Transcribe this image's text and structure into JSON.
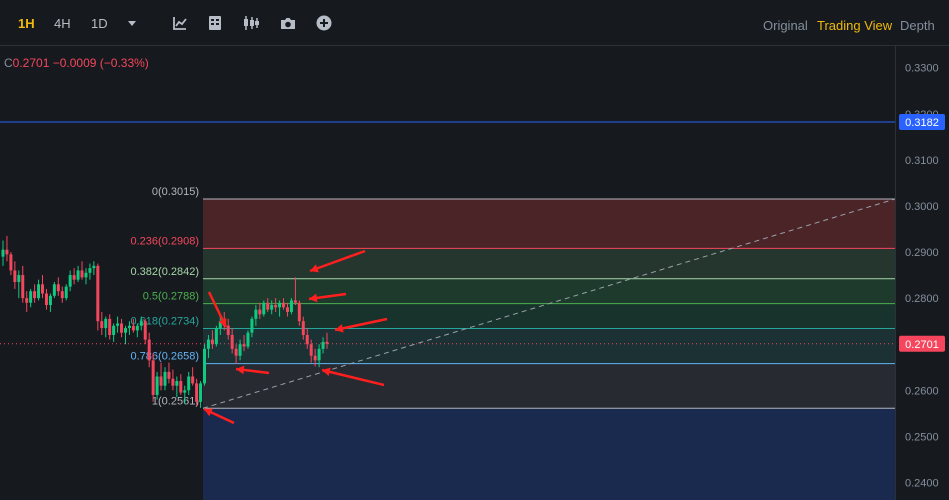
{
  "toolbar": {
    "timeframes": [
      {
        "label": "1H",
        "active": true
      },
      {
        "label": "4H",
        "active": false
      },
      {
        "label": "1D",
        "active": false
      }
    ],
    "icons": [
      "chevron-down-icon",
      "indicator-icon",
      "template-icon",
      "candle-type-icon",
      "camera-icon",
      "add-icon"
    ],
    "views": [
      {
        "label": "Original",
        "active": false
      },
      {
        "label": "Trading View",
        "active": true
      },
      {
        "label": "Depth",
        "active": false
      }
    ]
  },
  "legend": {
    "close_label": "C",
    "close": "0.2701",
    "change": "−0.0009",
    "change_pct": "(−0.33%)"
  },
  "colors": {
    "bg": "#161a1e",
    "up": "#0ecb81",
    "down": "#f6465d",
    "accent": "#f0b90b",
    "horizontal_line": "#2962ff",
    "arrow": "#ff1f1f"
  },
  "chart_data": {
    "type": "candlestick",
    "price_axis": {
      "ticks": [
        "0.3300",
        "0.3200",
        "0.3100",
        "0.3000",
        "0.2900",
        "0.2800",
        "0.2700",
        "0.2600",
        "0.2500",
        "0.2400"
      ],
      "tick_values": [
        0.33,
        0.32,
        0.31,
        0.3,
        0.29,
        0.28,
        0.27,
        0.26,
        0.25,
        0.24
      ],
      "range": [
        0.2362,
        0.3347
      ]
    },
    "horizontal_line": {
      "price": 0.3182,
      "label": "0.3182"
    },
    "current_price": {
      "price": 0.2701,
      "label": "0.2701"
    },
    "fib_levels": [
      {
        "ratio": "0",
        "price": 0.3015,
        "label": "0(0.3015)",
        "color": "#b2b5be",
        "fill": "#4a2427"
      },
      {
        "ratio": "0.236",
        "price": 0.2908,
        "label": "0.236(0.2908)",
        "color": "#f6465d",
        "fill": "#24362e"
      },
      {
        "ratio": "0.382",
        "price": 0.2842,
        "label": "0.382(0.2842)",
        "color": "#a5d6a7",
        "fill": "#1d3a2c"
      },
      {
        "ratio": "0.5",
        "price": 0.2788,
        "label": "0.5(0.2788)",
        "color": "#4caf50",
        "fill": "#18332b"
      },
      {
        "ratio": "0.618",
        "price": 0.2734,
        "label": "0.618(0.2734)",
        "color": "#26a69a",
        "fill": "#1b3134"
      },
      {
        "ratio": "0.786",
        "price": 0.2658,
        "label": "0.786(0.2658)",
        "color": "#64b5f6",
        "fill": "#272a31"
      },
      {
        "ratio": "1",
        "price": 0.2561,
        "label": "1(0.2561)",
        "color": "#b2b5be",
        "fill": "#1a2a4f"
      }
    ],
    "trend_line": {
      "from_price": 0.2561,
      "to_price": 0.3015
    },
    "arrows": [
      {
        "target_price": 0.2842,
        "direction": "left"
      },
      {
        "target_price": 0.28,
        "direction": "left"
      },
      {
        "target_price": 0.2785,
        "direction": "down-right"
      },
      {
        "target_price": 0.274,
        "direction": "left"
      },
      {
        "target_price": 0.2657,
        "direction": "left"
      },
      {
        "target_price": 0.2652,
        "direction": "left"
      },
      {
        "target_price": 0.2562,
        "direction": "left"
      }
    ],
    "candles": [
      [
        0.289,
        0.2925,
        0.287,
        0.2905
      ],
      [
        0.2905,
        0.2935,
        0.288,
        0.2895
      ],
      [
        0.2895,
        0.29,
        0.285,
        0.286
      ],
      [
        0.286,
        0.288,
        0.282,
        0.2835
      ],
      [
        0.2835,
        0.286,
        0.28,
        0.285
      ],
      [
        0.285,
        0.287,
        0.279,
        0.28
      ],
      [
        0.28,
        0.2815,
        0.277,
        0.279
      ],
      [
        0.279,
        0.282,
        0.278,
        0.2815
      ],
      [
        0.2815,
        0.283,
        0.279,
        0.28
      ],
      [
        0.28,
        0.284,
        0.2795,
        0.283
      ],
      [
        0.283,
        0.285,
        0.28,
        0.281
      ],
      [
        0.281,
        0.282,
        0.2775,
        0.2785
      ],
      [
        0.2785,
        0.281,
        0.277,
        0.2805
      ],
      [
        0.2805,
        0.2835,
        0.28,
        0.283
      ],
      [
        0.283,
        0.2845,
        0.2805,
        0.2815
      ],
      [
        0.2815,
        0.2825,
        0.279,
        0.28
      ],
      [
        0.28,
        0.283,
        0.2795,
        0.2825
      ],
      [
        0.2825,
        0.286,
        0.2815,
        0.285
      ],
      [
        0.285,
        0.2865,
        0.283,
        0.284
      ],
      [
        0.284,
        0.287,
        0.2835,
        0.286
      ],
      [
        0.286,
        0.288,
        0.284,
        0.2845
      ],
      [
        0.2845,
        0.2865,
        0.283,
        0.2855
      ],
      [
        0.2855,
        0.2875,
        0.284,
        0.2865
      ],
      [
        0.2865,
        0.288,
        0.285,
        0.287
      ],
      [
        0.287,
        0.2875,
        0.273,
        0.275
      ],
      [
        0.275,
        0.277,
        0.272,
        0.2735
      ],
      [
        0.2735,
        0.276,
        0.2715,
        0.2755
      ],
      [
        0.2755,
        0.2765,
        0.271,
        0.272
      ],
      [
        0.272,
        0.2745,
        0.2705,
        0.274
      ],
      [
        0.274,
        0.276,
        0.2725,
        0.2745
      ],
      [
        0.2745,
        0.2755,
        0.2715,
        0.2725
      ],
      [
        0.2725,
        0.274,
        0.27,
        0.2735
      ],
      [
        0.2735,
        0.275,
        0.272,
        0.274
      ],
      [
        0.274,
        0.2755,
        0.2725,
        0.273
      ],
      [
        0.273,
        0.2745,
        0.2715,
        0.274
      ],
      [
        0.274,
        0.276,
        0.273,
        0.275
      ],
      [
        0.275,
        0.2755,
        0.27,
        0.271
      ],
      [
        0.271,
        0.2725,
        0.265,
        0.2665
      ],
      [
        0.2665,
        0.268,
        0.2575,
        0.259
      ],
      [
        0.259,
        0.264,
        0.258,
        0.263
      ],
      [
        0.263,
        0.266,
        0.26,
        0.261
      ],
      [
        0.261,
        0.265,
        0.26,
        0.264
      ],
      [
        0.264,
        0.266,
        0.2615,
        0.2625
      ],
      [
        0.2625,
        0.2645,
        0.26,
        0.261
      ],
      [
        0.261,
        0.263,
        0.2585,
        0.262
      ],
      [
        0.262,
        0.2635,
        0.259,
        0.2595
      ],
      [
        0.2595,
        0.261,
        0.257,
        0.26
      ],
      [
        0.26,
        0.264,
        0.259,
        0.263
      ],
      [
        0.263,
        0.265,
        0.261,
        0.2615
      ],
      [
        0.2615,
        0.2625,
        0.2565,
        0.2575
      ],
      [
        0.2575,
        0.262,
        0.2562,
        0.2615
      ],
      [
        0.2615,
        0.27,
        0.261,
        0.269
      ],
      [
        0.269,
        0.272,
        0.267,
        0.271
      ],
      [
        0.271,
        0.273,
        0.269,
        0.27
      ],
      [
        0.27,
        0.274,
        0.2695,
        0.2735
      ],
      [
        0.2735,
        0.276,
        0.272,
        0.275
      ],
      [
        0.275,
        0.277,
        0.273,
        0.274
      ],
      [
        0.274,
        0.2755,
        0.271,
        0.272
      ],
      [
        0.272,
        0.2735,
        0.268,
        0.269
      ],
      [
        0.269,
        0.27,
        0.2657,
        0.2675
      ],
      [
        0.2675,
        0.271,
        0.2665,
        0.27
      ],
      [
        0.27,
        0.272,
        0.2685,
        0.2695
      ],
      [
        0.2695,
        0.273,
        0.269,
        0.2725
      ],
      [
        0.2725,
        0.276,
        0.2715,
        0.2755
      ],
      [
        0.2755,
        0.2785,
        0.274,
        0.2775
      ],
      [
        0.2775,
        0.279,
        0.2755,
        0.2765
      ],
      [
        0.2765,
        0.2795,
        0.276,
        0.279
      ],
      [
        0.279,
        0.28,
        0.277,
        0.2775
      ],
      [
        0.2775,
        0.2795,
        0.2765,
        0.2785
      ],
      [
        0.2785,
        0.28,
        0.277,
        0.278
      ],
      [
        0.278,
        0.2795,
        0.276,
        0.279
      ],
      [
        0.279,
        0.28,
        0.2775,
        0.278
      ],
      [
        0.278,
        0.279,
        0.276,
        0.277
      ],
      [
        0.277,
        0.28,
        0.2765,
        0.2795
      ],
      [
        0.2795,
        0.2845,
        0.2785,
        0.279
      ],
      [
        0.279,
        0.2795,
        0.274,
        0.275
      ],
      [
        0.275,
        0.276,
        0.271,
        0.272
      ],
      [
        0.272,
        0.2735,
        0.269,
        0.27
      ],
      [
        0.27,
        0.271,
        0.266,
        0.2675
      ],
      [
        0.2675,
        0.269,
        0.2652,
        0.2665
      ],
      [
        0.2665,
        0.27,
        0.265,
        0.269
      ],
      [
        0.269,
        0.2715,
        0.268,
        0.2705
      ],
      [
        0.2705,
        0.2725,
        0.269,
        0.2701
      ]
    ]
  }
}
